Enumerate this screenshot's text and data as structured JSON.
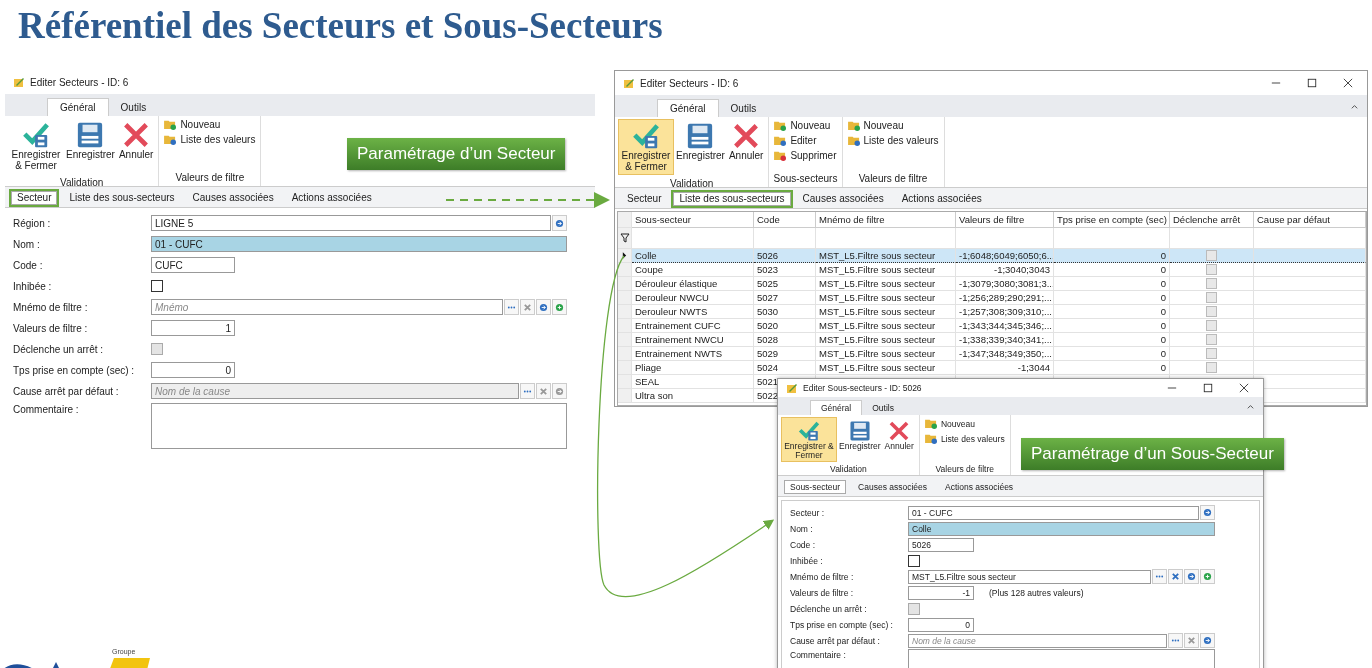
{
  "title": "Référentiel des Secteurs et Sous-Secteurs",
  "callouts": [
    {
      "text": "Paramétrage d’un Secteur"
    },
    {
      "text": "Paramétrage d’un Sous-Secteur"
    }
  ],
  "windows": [
    {
      "title": "Editer Secteurs - ID: 6",
      "window_controls": false,
      "ribbon_tabs": [
        {
          "label": "Général",
          "selected": true
        },
        {
          "label": "Outils",
          "selected": false
        }
      ],
      "ribbon_groups": [
        {
          "label": "Validation",
          "items": [
            {
              "kind": "save-close",
              "label": "Enregistrer & Fermer",
              "highlighted": false
            },
            {
              "kind": "save",
              "label": "Enregistrer",
              "highlighted": false
            },
            {
              "kind": "cancel",
              "label": "Annuler",
              "highlighted": false
            }
          ]
        },
        {
          "label": "Valeurs de filtre",
          "items": [
            {
              "kind": "new",
              "label": "Nouveau"
            },
            {
              "kind": "list",
              "label": "Liste des valeurs"
            }
          ]
        }
      ],
      "tabs": [
        {
          "label": "Secteur",
          "selected": true,
          "highlighted": true
        },
        {
          "label": "Liste des sous-secteurs",
          "selected": false,
          "highlighted": false
        },
        {
          "label": "Causes associées",
          "selected": false,
          "highlighted": false
        },
        {
          "label": "Actions associées",
          "selected": false,
          "highlighted": false
        }
      ],
      "content": {
        "kind": "form",
        "fields": [
          {
            "label": "Région :",
            "kind": "combo",
            "value": "LIGNE 5",
            "buttons": [
              {
                "kind": "go",
                "disabled": false
              }
            ]
          },
          {
            "label": "Nom :",
            "kind": "name",
            "value": "01 - CUFC"
          },
          {
            "label": "Code :",
            "kind": "short",
            "value": "CUFC"
          },
          {
            "label": "Inhibée :",
            "kind": "checkbox",
            "checked": false,
            "disabled": false
          },
          {
            "label": "Mnémo de filtre :",
            "kind": "combo",
            "placeholder": "Mnémo",
            "disabled": false,
            "buttons": [
              {
                "kind": "more",
                "disabled": false
              },
              {
                "kind": "clear",
                "disabled": true
              },
              {
                "kind": "go",
                "disabled": false
              },
              {
                "kind": "add",
                "disabled": false
              }
            ]
          },
          {
            "label": "Valeurs de filtre :",
            "kind": "number",
            "value": "1"
          },
          {
            "label": "Déclenche un arrêt :",
            "kind": "checkbox",
            "checked": false,
            "disabled": true
          },
          {
            "label": "Tps prise en compte (sec) :",
            "kind": "number",
            "value": "0"
          },
          {
            "label": "Cause arrêt par défaut :",
            "kind": "combo",
            "placeholder": "Nom de la cause",
            "disabled": true,
            "buttons": [
              {
                "kind": "more",
                "disabled": false
              },
              {
                "kind": "clear",
                "disabled": true
              },
              {
                "kind": "go",
                "disabled": true
              }
            ]
          },
          {
            "label": "Commentaire :",
            "kind": "memo"
          }
        ]
      }
    },
    {
      "title": "Editer Secteurs - ID: 6",
      "window_controls": true,
      "ribbon_tabs": [
        {
          "label": "Général",
          "selected": true
        },
        {
          "label": "Outils",
          "selected": false
        }
      ],
      "ribbon_groups": [
        {
          "label": "Validation",
          "items": [
            {
              "kind": "save-close",
              "label": "Enregistrer & Fermer",
              "highlighted": true
            },
            {
              "kind": "save",
              "label": "Enregistrer",
              "highlighted": false
            },
            {
              "kind": "cancel",
              "label": "Annuler",
              "highlighted": false
            }
          ]
        },
        {
          "label": "Sous-secteurs",
          "items": [
            {
              "kind": "new",
              "label": "Nouveau"
            },
            {
              "kind": "list",
              "label": "Editer"
            },
            {
              "kind": "delete",
              "label": "Supprimer"
            }
          ]
        },
        {
          "label": "Valeurs de filtre",
          "items": [
            {
              "kind": "new",
              "label": "Nouveau"
            },
            {
              "kind": "list",
              "label": "Liste des valeurs"
            }
          ]
        }
      ],
      "tabs": [
        {
          "label": "Secteur",
          "selected": false,
          "highlighted": false
        },
        {
          "label": "Liste des sous-secteurs",
          "selected": true,
          "highlighted": true
        },
        {
          "label": "Causes associées",
          "selected": false,
          "highlighted": false
        },
        {
          "label": "Actions associées",
          "selected": false,
          "highlighted": false
        }
      ],
      "content": {
        "kind": "grid",
        "columns": [
          "Sous-secteur",
          "Code",
          "Mnémo de filtre",
          "Valeurs de filtre",
          "Tps prise en compte (sec)",
          "Déclenche arrêt",
          "Cause par défaut"
        ],
        "rows": [
          {
            "name": "Colle",
            "code": "5026",
            "mnemo": "MST_L5.Filtre sous secteur",
            "values": "-1;6048;6049;6050;6...",
            "delay": "0",
            "stop": false,
            "selected": true
          },
          {
            "name": "Coupe",
            "code": "5023",
            "mnemo": "MST_L5.Filtre sous secteur",
            "values": "-1;3040;3043",
            "delay": "0",
            "stop": false,
            "selected": false
          },
          {
            "name": "Dérouleur élastique",
            "code": "5025",
            "mnemo": "MST_L5.Filtre sous secteur",
            "values": "-1;3079;3080;3081;3...",
            "delay": "0",
            "stop": false,
            "selected": false
          },
          {
            "name": "Derouleur NWCU",
            "code": "5027",
            "mnemo": "MST_L5.Filtre sous secteur",
            "values": "-1;256;289;290;291;...",
            "delay": "0",
            "stop": false,
            "selected": false
          },
          {
            "name": "Derouleur NWTS",
            "code": "5030",
            "mnemo": "MST_L5.Filtre sous secteur",
            "values": "-1;257;308;309;310;...",
            "delay": "0",
            "stop": false,
            "selected": false
          },
          {
            "name": "Entrainement  CUFC",
            "code": "5020",
            "mnemo": "MST_L5.Filtre sous secteur",
            "values": "-1;343;344;345;346;...",
            "delay": "0",
            "stop": false,
            "selected": false
          },
          {
            "name": "Entrainement  NWCU",
            "code": "5028",
            "mnemo": "MST_L5.Filtre sous secteur",
            "values": "-1;338;339;340;341;...",
            "delay": "0",
            "stop": false,
            "selected": false
          },
          {
            "name": "Entrainement NWTS",
            "code": "5029",
            "mnemo": "MST_L5.Filtre sous secteur",
            "values": "-1;347;348;349;350;...",
            "delay": "0",
            "stop": false,
            "selected": false
          },
          {
            "name": "Pliage",
            "code": "5024",
            "mnemo": "MST_L5.Filtre sous secteur",
            "values": "-1;3044",
            "delay": "0",
            "stop": false,
            "selected": false
          },
          {
            "name": "SEAL",
            "code": "5021",
            "selected": false
          },
          {
            "name": "Ultra son",
            "code": "5022",
            "selected": false
          }
        ]
      }
    },
    {
      "title": "Editer Sous-secteurs - ID: 5026",
      "window_controls": true,
      "ribbon_tabs": [
        {
          "label": "Général",
          "selected": true
        },
        {
          "label": "Outils",
          "selected": false
        }
      ],
      "ribbon_groups": [
        {
          "label": "Validation",
          "items": [
            {
              "kind": "save-close",
              "label": "Enregistrer & Fermer",
              "highlighted": true
            },
            {
              "kind": "save",
              "label": "Enregistrer",
              "highlighted": false
            },
            {
              "kind": "cancel",
              "label": "Annuler",
              "highlighted": false
            }
          ]
        },
        {
          "label": "Valeurs de filtre",
          "items": [
            {
              "kind": "new",
              "label": "Nouveau"
            },
            {
              "kind": "list",
              "label": "Liste des valeurs"
            }
          ]
        }
      ],
      "tabs": [
        {
          "label": "Sous-secteur",
          "selected": true,
          "highlighted": false
        },
        {
          "label": "Causes associées",
          "selected": false,
          "highlighted": false
        },
        {
          "label": "Actions associées",
          "selected": false,
          "highlighted": false
        }
      ],
      "content": {
        "kind": "form",
        "fields": [
          {
            "label": "Secteur :",
            "kind": "combo",
            "value": "01 - CUFC",
            "buttons": [
              {
                "kind": "go",
                "disabled": false
              }
            ]
          },
          {
            "label": "Nom :",
            "kind": "name",
            "value": "Colle"
          },
          {
            "label": "Code :",
            "kind": "short",
            "value": "5026"
          },
          {
            "label": "Inhibée :",
            "kind": "checkbox",
            "checked": false,
            "disabled": false
          },
          {
            "label": "Mnémo de filtre :",
            "kind": "combo",
            "value": "MST_L5.Filtre sous secteur",
            "disabled": false,
            "buttons": [
              {
                "kind": "more",
                "disabled": false
              },
              {
                "kind": "clear",
                "disabled": false
              },
              {
                "kind": "go",
                "disabled": false
              },
              {
                "kind": "add",
                "disabled": false
              }
            ]
          },
          {
            "label": "Valeurs de filtre :",
            "kind": "number",
            "value": "-1",
            "note": "(Plus 128 autres valeurs)"
          },
          {
            "label": "Déclenche un arrêt :",
            "kind": "checkbox",
            "checked": false,
            "disabled": true
          },
          {
            "label": "Tps prise en compte (sec) :",
            "kind": "number",
            "value": "0"
          },
          {
            "label": "Cause arrêt par défaut :",
            "kind": "combo",
            "placeholder": "Nom de la cause",
            "disabled": false,
            "buttons": [
              {
                "kind": "more",
                "disabled": false
              },
              {
                "kind": "clear",
                "disabled": true
              },
              {
                "kind": "go",
                "disabled": false
              }
            ]
          },
          {
            "label": "Commentaire :",
            "kind": "memo"
          }
        ]
      }
    }
  ],
  "logo": {
    "caption": "Groupe"
  }
}
